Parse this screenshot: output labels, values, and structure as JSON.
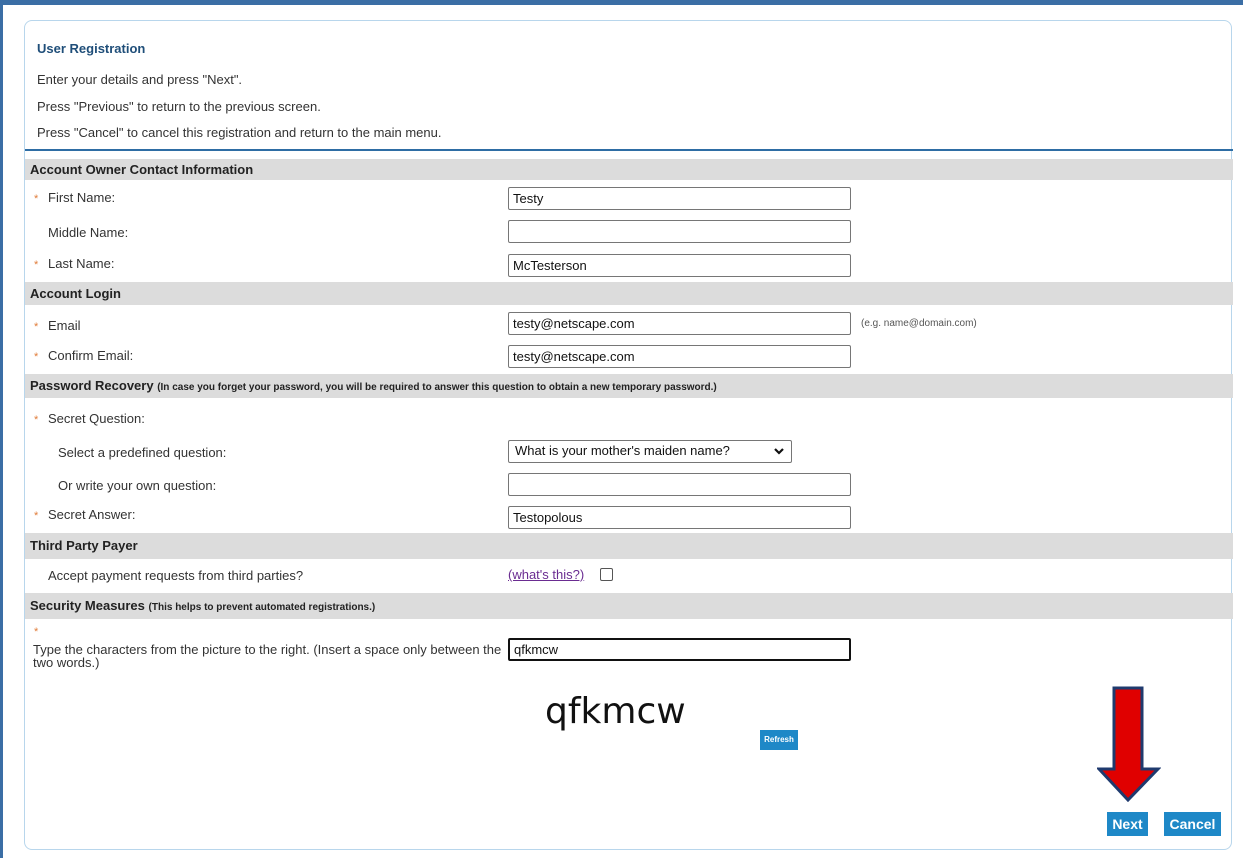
{
  "header": {
    "title": "User Registration",
    "intro": [
      "Enter your details and press \"Next\".",
      "Press \"Previous\" to return to the previous screen.",
      "Press \"Cancel\" to cancel this registration and return to the main menu."
    ]
  },
  "required_marker": "*",
  "sections": {
    "contact": {
      "title": "Account Owner Contact Information",
      "first_name_label": "First Name:",
      "first_name_value": "Testy",
      "middle_name_label": "Middle Name:",
      "middle_name_value": "",
      "last_name_label": "Last Name:",
      "last_name_value": "McTesterson"
    },
    "login": {
      "title": "Account Login",
      "email_label": "Email",
      "email_value": "testy@netscape.com",
      "email_hint": "(e.g. name@domain.com)",
      "confirm_email_label": "Confirm Email:",
      "confirm_email_value": "testy@netscape.com"
    },
    "recovery": {
      "title": "Password Recovery",
      "note": "(In case you forget your password, you will be required to answer this question to obtain a new temporary password.)",
      "secret_question_label": "Secret Question:",
      "predefined_label": "Select a predefined question:",
      "predefined_value": "What is your mother's maiden name?",
      "own_question_label": "Or write your own question:",
      "own_question_value": "",
      "secret_answer_label": "Secret Answer:",
      "secret_answer_value": "Testopolous"
    },
    "third_party": {
      "title": "Third Party Payer",
      "accept_label": "Accept payment requests from third parties?",
      "whats_this": "(what's this?)",
      "accept_checked": false
    },
    "security": {
      "title": "Security Measures",
      "note": "(This helps to prevent automated registrations.)",
      "captcha_instruction": "Type the characters from the picture to the right. (Insert a space only between the two words.)",
      "captcha_value": "qfkmcw",
      "captcha_image_text": "qfkmcw",
      "refresh_label": "Refresh"
    }
  },
  "actions": {
    "next_label": "Next",
    "cancel_label": "Cancel"
  },
  "colors": {
    "accent": "#1e88c7",
    "section_bg": "#dcdcdc",
    "required": "#e07b39",
    "arrow": "#e00000"
  },
  "icons": {
    "select_chevron": "chevron-down-icon",
    "annotation_arrow": "arrow-down-icon"
  }
}
